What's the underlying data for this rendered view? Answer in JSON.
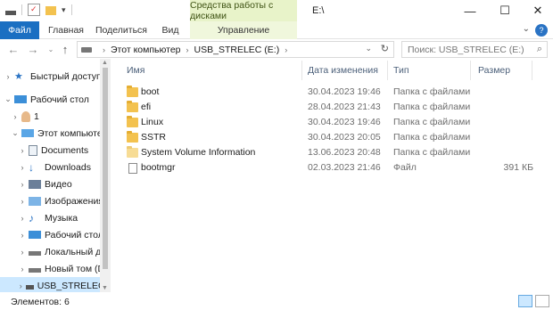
{
  "titlebar": {
    "title": "E:\\",
    "tools_tab": "Средства работы с дисками",
    "minimize": "—",
    "maximize": "☐",
    "close": "✕"
  },
  "ribbon": {
    "tabs": [
      {
        "label": "Файл"
      },
      {
        "label": "Главная"
      },
      {
        "label": "Поделиться"
      },
      {
        "label": "Вид"
      },
      {
        "label": "Управление"
      }
    ],
    "help": "?",
    "expand": "⌄"
  },
  "address": {
    "breadcrumbs": [
      "Этот компьютер",
      "USB_STRELEC (E:)"
    ],
    "search_placeholder": "Поиск: USB_STRELEC (E:)"
  },
  "nav": {
    "items": [
      {
        "label": "Быстрый доступ",
        "icon": "star-icon",
        "chev": "›"
      },
      {
        "label": "Рабочий стол",
        "icon": "desktop-icon",
        "chev": "⌄"
      },
      {
        "label": "1",
        "icon": "user-icon",
        "chev": "›"
      },
      {
        "label": "Этот компьютер",
        "icon": "computer-icon",
        "chev": "⌄"
      },
      {
        "label": "Documents",
        "icon": "documents-icon",
        "chev": "›"
      },
      {
        "label": "Downloads",
        "icon": "downloads-icon",
        "chev": "›"
      },
      {
        "label": "Видео",
        "icon": "video-icon",
        "chev": "›"
      },
      {
        "label": "Изображения",
        "icon": "pictures-icon",
        "chev": "›"
      },
      {
        "label": "Музыка",
        "icon": "music-icon",
        "chev": "›"
      },
      {
        "label": "Рабочий стол",
        "icon": "desktop-icon",
        "chev": "›"
      },
      {
        "label": "Локальный ди",
        "icon": "drive-icon",
        "chev": "›"
      },
      {
        "label": "Новый том (D",
        "icon": "drive-icon",
        "chev": "›"
      },
      {
        "label": "USB_STRELEC (",
        "icon": "usb-drive-icon",
        "chev": "›"
      }
    ]
  },
  "columns": {
    "name": "Имя",
    "date": "Дата изменения",
    "type": "Тип",
    "size": "Размер"
  },
  "files": [
    {
      "name": "boot",
      "date": "30.04.2023 19:46",
      "type": "Папка с файлами",
      "size": "",
      "icon": "folder-icon"
    },
    {
      "name": "efi",
      "date": "28.04.2023 21:43",
      "type": "Папка с файлами",
      "size": "",
      "icon": "folder-icon"
    },
    {
      "name": "Linux",
      "date": "30.04.2023 19:46",
      "type": "Папка с файлами",
      "size": "",
      "icon": "folder-icon"
    },
    {
      "name": "SSTR",
      "date": "30.04.2023 20:05",
      "type": "Папка с файлами",
      "size": "",
      "icon": "folder-icon"
    },
    {
      "name": "System Volume Information",
      "date": "13.06.2023 20:48",
      "type": "Папка с файлами",
      "size": "",
      "icon": "folder-icon"
    },
    {
      "name": "bootmgr",
      "date": "02.03.2023 21:46",
      "type": "Файл",
      "size": "391 КБ",
      "icon": "file-icon"
    }
  ],
  "status": {
    "count": "Элементов: 6"
  },
  "colors": {
    "file_tab": "#1a6fc2",
    "tools_tab": "#e8f3c9",
    "selection": "#cce8ff",
    "folder": "#f3c24f"
  }
}
